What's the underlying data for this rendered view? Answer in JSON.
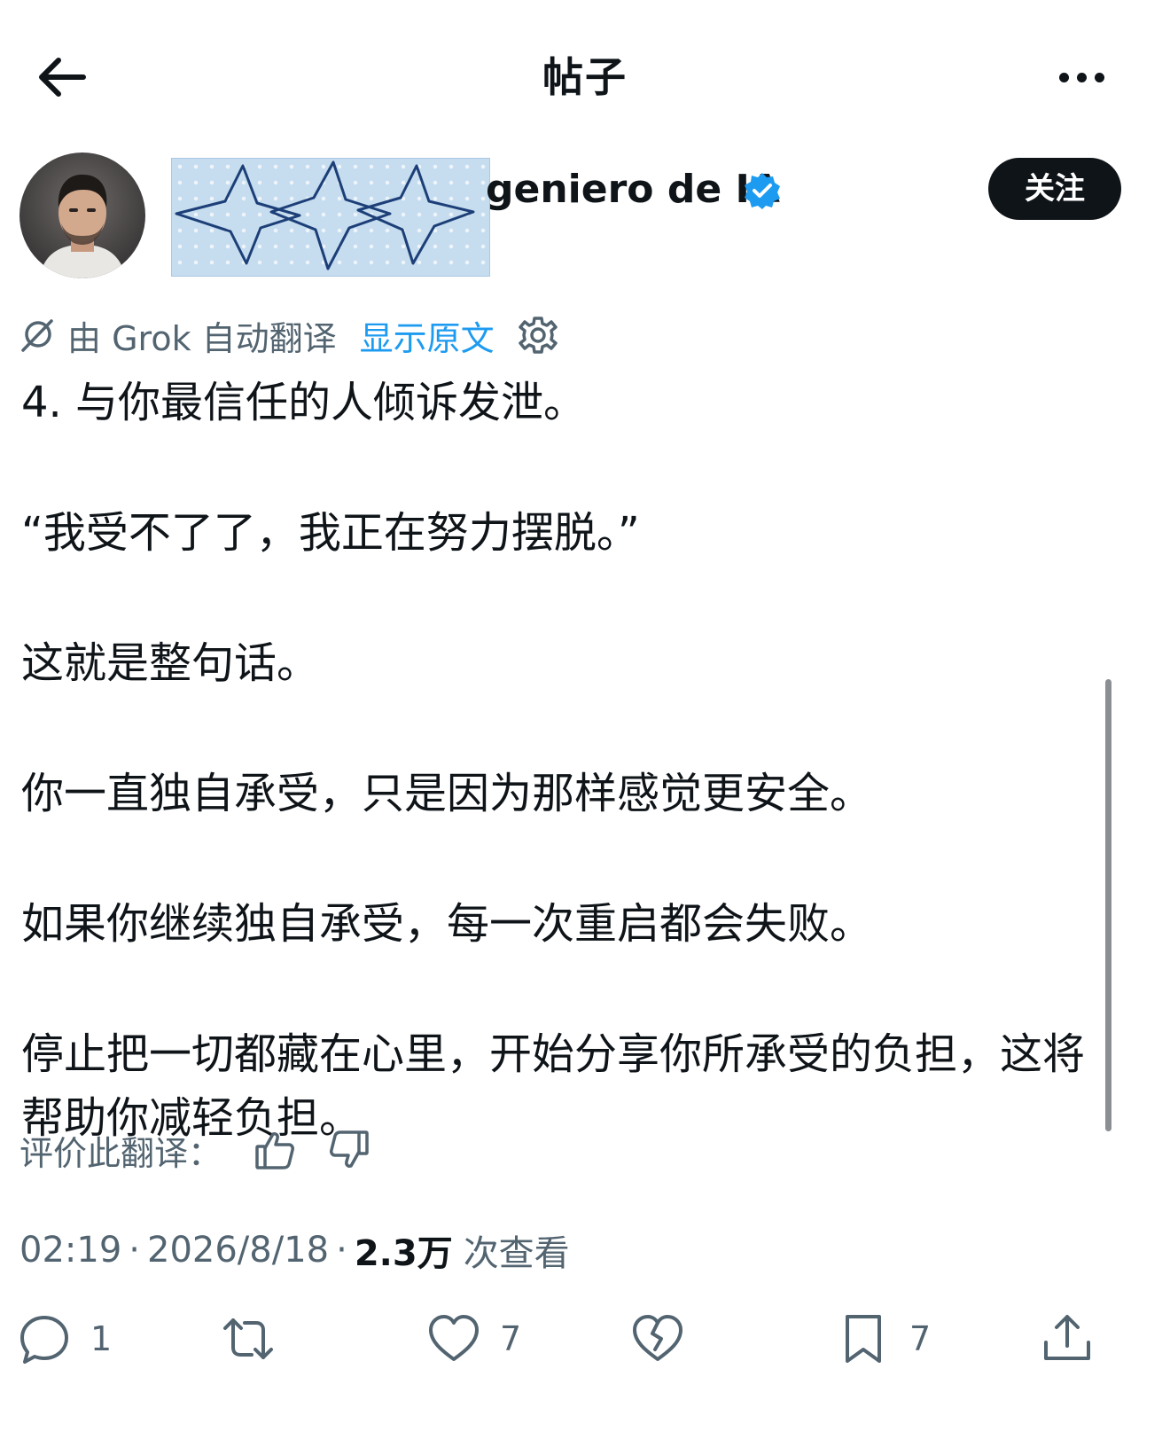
{
  "header": {
    "title": "帖子"
  },
  "author": {
    "name_visible": "geniero de IA",
    "follow_label": "关注",
    "verified": true
  },
  "translation": {
    "provider_text": "由 Grok 自动翻译",
    "show_original_label": "显示原文"
  },
  "post": {
    "paragraphs": [
      "4. 与你最信任的人倾诉发泄。",
      "“我受不了了，我正在努力摆脱。”",
      "这就是整句话。",
      "你一直独自承受，只是因为那样感觉更安全。",
      "如果你继续独自承受，每一次重启都会失败。",
      "停止把一切都藏在心里，开始分享你所承受的负担，这将帮助你减轻负担。"
    ]
  },
  "rate": {
    "label": "评价此翻译："
  },
  "meta": {
    "time": "02:19",
    "date": "2026/8/18",
    "separator": "·",
    "views_count": "2.3万",
    "views_label": "次查看"
  },
  "actions": {
    "reply_count": "1",
    "like_count": "7",
    "bookmark_count": "7"
  },
  "colors": {
    "text_primary": "#0f1419",
    "text_secondary": "#536471",
    "accent": "#1d9bf0",
    "follow_button_bg": "#0f1419"
  },
  "icons": [
    "back-arrow-icon",
    "more-icon",
    "verified-badge-icon",
    "grok-icon",
    "gear-icon",
    "thumbs-up-icon",
    "thumbs-down-icon",
    "reply-icon",
    "retweet-icon",
    "like-icon",
    "dislike-icon",
    "bookmark-icon",
    "share-icon"
  ]
}
